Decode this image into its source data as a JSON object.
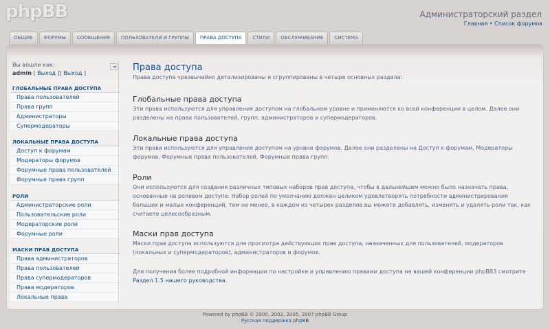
{
  "header": {
    "logo": "phpBB",
    "admin_title": "Администраторский раздел",
    "link_index": "Главная",
    "link_sep": " • ",
    "link_forums": "Список форумов"
  },
  "tabs": [
    {
      "label": "ОБЩИЕ"
    },
    {
      "label": "ФОРУМЫ"
    },
    {
      "label": "СООБЩЕНИЯ"
    },
    {
      "label": "ПОЛЬЗОВАТЕЛИ И ГРУППЫ"
    },
    {
      "label": "ПРАВА ДОСТУПА",
      "active": true
    },
    {
      "label": "СТИЛИ"
    },
    {
      "label": "ОБСЛУЖИВАНИЕ"
    },
    {
      "label": "СИСТЕМА"
    }
  ],
  "menu": {
    "logged_in_as": "Вы вошли как:",
    "username": "admin",
    "logout_open": " [ ",
    "logout_label": "Выход",
    "logout_mid": " ][ ",
    "logout_label2": "Выход",
    "logout_close": " ]",
    "collapse_icon": "◄",
    "blocks": [
      {
        "title": "ГЛОБАЛЬНЫЕ ПРАВА ДОСТУПА",
        "items": [
          "Права пользователей",
          "Права групп",
          "Администраторы",
          "Супермодераторы"
        ]
      },
      {
        "title": "ЛОКАЛЬНЫЕ ПРАВА ДОСТУПА",
        "items": [
          "Доступ к форумам",
          "Модераторы форумов",
          "Форумные права пользователей",
          "Форумные права групп"
        ]
      },
      {
        "title": "РОЛИ",
        "items": [
          "Администраторские роли",
          "Пользовательские роли",
          "Модераторские роли",
          "Форумные роли"
        ]
      },
      {
        "title": "МАСКИ ПРАВ ДОСТУПА",
        "items": [
          "Права администраторов",
          "Права пользователей",
          "Права супермодераторов",
          "Права модераторов",
          "Локальные права"
        ]
      }
    ]
  },
  "main": {
    "title": "Права доступа",
    "intro": "Права доступа чрезвычайно детализированы и сгруппированы в четыре основных раздела:",
    "sections": [
      {
        "heading": "Глобальные права доступа",
        "text": "Эти права используются для управления доступом на глобальном уровне и применяются ко всей конференции в целом. Далее они разделены на права пользователей, групп, администраторов и супермодераторов."
      },
      {
        "heading": "Локальные права доступа",
        "text": "Эти права используются для управления доступом на уровне форумов. Далее они разделены на Доступ к форумам, Модераторы форумов, Форумные права пользователей, Форумные права групп."
      },
      {
        "heading": "Роли",
        "text": "Они используются для создания различных типовых наборов прав доступа, чтобы в дальнейшем можно было назначать права, основанные на ролевом доступе. Набор ролей по умолчанию должен целиком удовлетворять потребности администрирования больших и малых конференций, тем не менее, в каждом из четырех разделов вы можете добавлять, изменять и удалять роли так, как считаете целесообразным."
      },
      {
        "heading": "Маски прав доступа",
        "text": "Маски прав доступа используются для просмотра действующих прав доступа, назначенных для пользователей, модераторов (локальных и супермодераторов), администраторов и форумов."
      }
    ],
    "more_text": "Для получения более подробной информации по настройке и управлению правами доступа на вашей конференции phpBB3 смотрите",
    "more_link": "Раздел 1.5 нашего руководства",
    "more_end": "."
  },
  "footer": {
    "powered": "Powered by phpBB © 2000, 2002, 2005, 2007 phpBB Group",
    "support": "Русская поддержка phpBB"
  }
}
